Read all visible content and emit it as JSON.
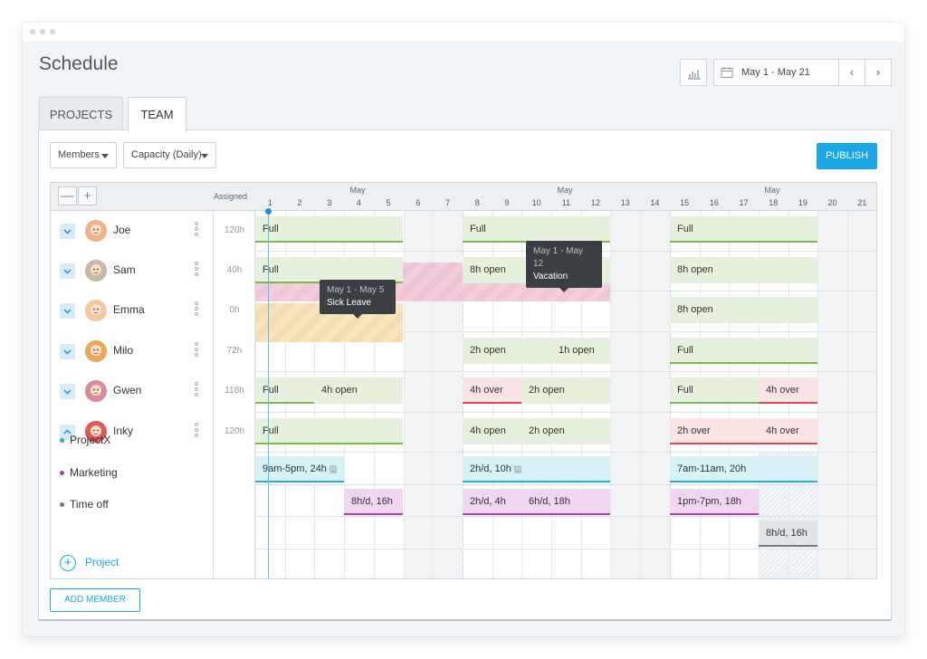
{
  "title": "Schedule",
  "date_range": "May 1 - May 21",
  "nav": {
    "prev": "‹",
    "next": "›"
  },
  "icons": {
    "chart": "bar-chart-icon",
    "calendar": "calendar-icon"
  },
  "tabs": [
    {
      "label": "PROJECTS",
      "active": false
    },
    {
      "label": "TEAM",
      "active": true
    }
  ],
  "toolbar": {
    "members": "Members",
    "capacity": "Capacity (Daily)",
    "publish": "PUBLISH"
  },
  "grid_header": {
    "collapse": "—",
    "expand": "+",
    "assigned": "Assigned",
    "months": [
      "May",
      "May",
      "May"
    ]
  },
  "days": [
    "1",
    "2",
    "3",
    "4",
    "5",
    "6",
    "7",
    "8",
    "9",
    "10",
    "11",
    "12",
    "13",
    "14",
    "15",
    "16",
    "17",
    "18",
    "19",
    "20",
    "21"
  ],
  "members": [
    {
      "name": "Joe",
      "hours": "120h",
      "avatar_color": "#f0b28a"
    },
    {
      "name": "Sam",
      "hours": "40h",
      "avatar_color": "#c9b8a6"
    },
    {
      "name": "Emma",
      "hours": "0h",
      "avatar_color": "#f5c9a0"
    },
    {
      "name": "Milo",
      "hours": "72h",
      "avatar_color": "#e8a85a"
    },
    {
      "name": "Gwen",
      "hours": "118h",
      "avatar_color": "#d98ca0"
    },
    {
      "name": "Inky",
      "hours": "120h",
      "avatar_color": "#e05a5a"
    }
  ],
  "projects": [
    {
      "name": "ProjectX",
      "color": "#25aed0"
    },
    {
      "name": "Marketing",
      "color": "#a43fab"
    },
    {
      "name": "Time off",
      "color": "#6f7b85"
    }
  ],
  "bars": {
    "joe": [
      "Full",
      "Full",
      "Full"
    ],
    "sam": [
      "Full",
      "8h open",
      "8h open"
    ],
    "emma": [
      "8h open"
    ],
    "milo": [
      "2h open",
      "1h open",
      "Full"
    ],
    "gwen": [
      "Full",
      "4h open",
      "4h over",
      "2h open",
      "Full",
      "4h over"
    ],
    "inky": [
      "Full",
      "4h open",
      "2h open",
      "2h over",
      "4h over"
    ],
    "projectx": [
      "9am-5pm, 24h",
      "2h/d, 10h",
      "7am-11am, 20h"
    ],
    "marketing": [
      "8h/d, 16h",
      "2h/d, 4h",
      "6h/d, 18h",
      "1pm-7pm, 18h"
    ],
    "timeoff": [
      "8h/d, 16h"
    ]
  },
  "tooltips": {
    "vacation": {
      "dates": "May 1 - May 12",
      "label": "Vacation"
    },
    "sick": {
      "dates": "May 1 - May 5",
      "label": "Sick Leave"
    }
  },
  "add_project": "Project",
  "add_member": "ADD MEMBER"
}
